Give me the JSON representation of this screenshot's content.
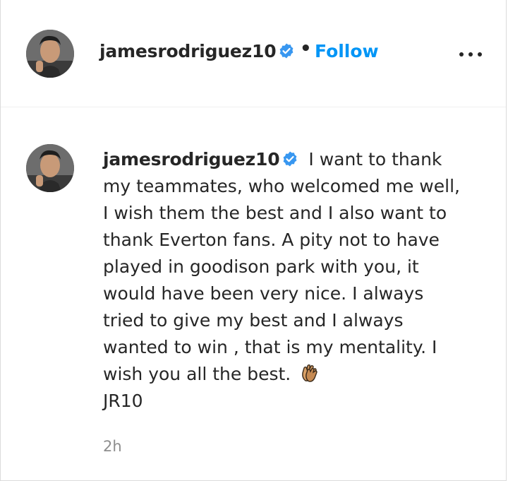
{
  "header": {
    "username": "jamesrodriguez10",
    "verified_icon": "verified-badge-icon",
    "separator": "•",
    "follow_label": "Follow",
    "more_icon": "more-options-icon"
  },
  "comment": {
    "username": "jamesrodriguez10",
    "verified_icon": "verified-badge-icon",
    "text": "I want to thank my teammates, who welcomed me well, I wish them the best and I also want to thank Everton fans. A pity not to have played in goodison park with you, it would have been very nice. I always tried to give my best and I always wanted to win , that is my mentality. I wish you all the best.",
    "emoji": "clapping-hands-icon",
    "signoff": "JR10",
    "timestamp": "2h"
  },
  "colors": {
    "accent": "#0095f6",
    "text": "#262626",
    "muted": "#8e8e8e"
  }
}
